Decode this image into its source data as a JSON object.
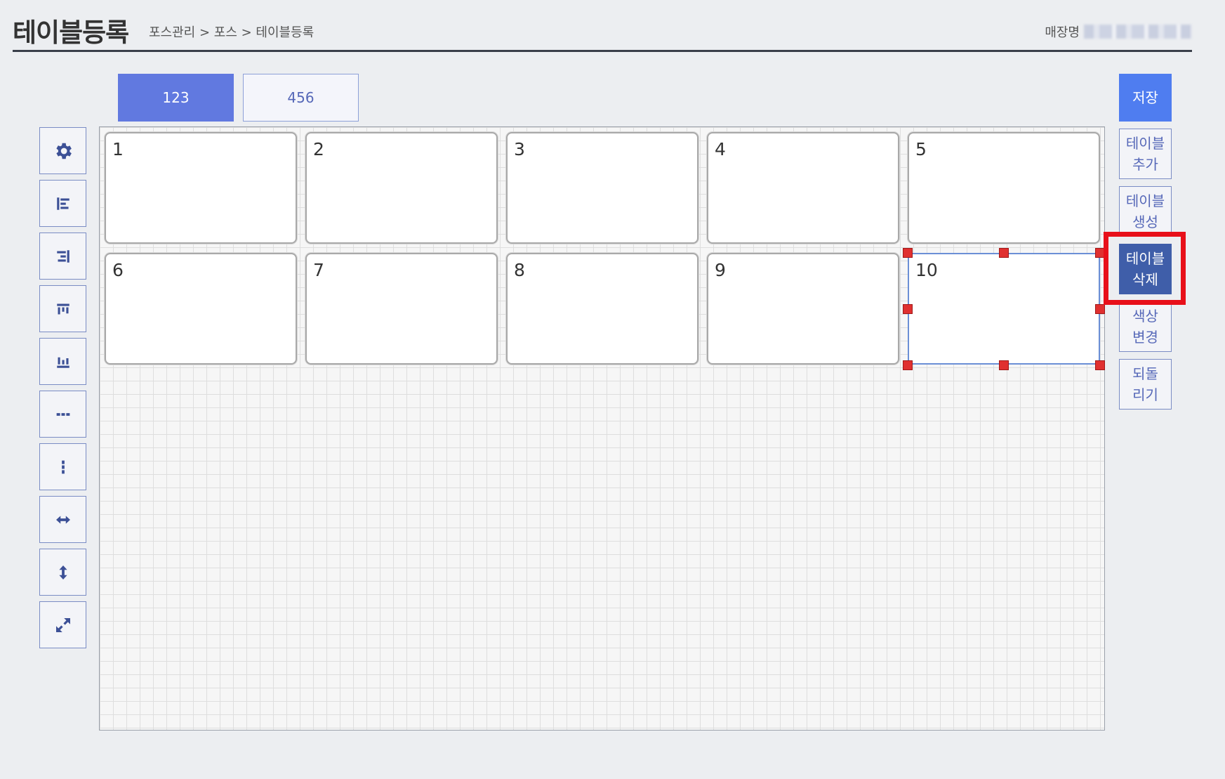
{
  "header": {
    "title": "테이블등록",
    "breadcrumb": "포스관리 > 포스 > 테이블등록",
    "store_label": "매장명"
  },
  "floor_tabs": [
    {
      "label": "123",
      "active": true
    },
    {
      "label": "456",
      "active": false
    }
  ],
  "toolbar": [
    {
      "icon": "gear-icon"
    },
    {
      "icon": "align-left-icon"
    },
    {
      "icon": "align-right-icon"
    },
    {
      "icon": "align-top-icon"
    },
    {
      "icon": "align-bottom-icon"
    },
    {
      "icon": "distribute-horizontal-icon"
    },
    {
      "icon": "distribute-vertical-icon"
    },
    {
      "icon": "same-width-icon"
    },
    {
      "icon": "same-height-icon"
    },
    {
      "icon": "same-size-icon"
    }
  ],
  "tables": [
    {
      "number": "1"
    },
    {
      "number": "2"
    },
    {
      "number": "3"
    },
    {
      "number": "4"
    },
    {
      "number": "5"
    },
    {
      "number": "6"
    },
    {
      "number": "7"
    },
    {
      "number": "8"
    },
    {
      "number": "9"
    },
    {
      "number": "10",
      "selected": true
    }
  ],
  "actions": {
    "save": "저장",
    "add": [
      "테이블",
      "추가"
    ],
    "create": [
      "테이블",
      "생성"
    ],
    "delete": [
      "테이블",
      "삭제"
    ],
    "color": [
      "색상",
      "변경"
    ],
    "undo": [
      "되돌",
      "리기"
    ]
  },
  "colors": {
    "accent": "#6179e0",
    "save": "#4f7df0",
    "active_action": "#3f5ea9",
    "highlight": "#e8101a",
    "handle": "#e03030"
  }
}
